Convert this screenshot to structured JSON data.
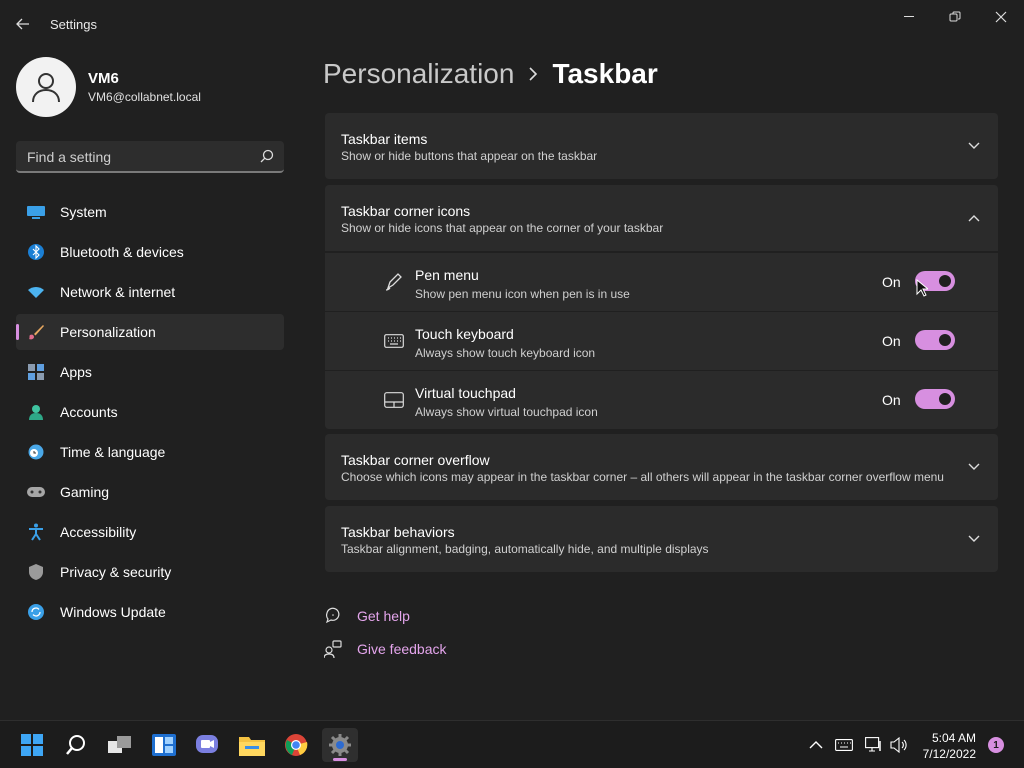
{
  "window": {
    "title": "Settings",
    "controls": [
      "minimize",
      "maximize",
      "close"
    ]
  },
  "profile": {
    "name": "VM6",
    "email": "VM6@collabnet.local"
  },
  "search": {
    "placeholder": "Find a setting"
  },
  "sidebar": {
    "items": [
      {
        "label": "System",
        "icon": "system-icon"
      },
      {
        "label": "Bluetooth & devices",
        "icon": "bluetooth-icon"
      },
      {
        "label": "Network & internet",
        "icon": "wifi-icon"
      },
      {
        "label": "Personalization",
        "icon": "brush-icon",
        "active": true
      },
      {
        "label": "Apps",
        "icon": "apps-icon"
      },
      {
        "label": "Accounts",
        "icon": "accounts-icon"
      },
      {
        "label": "Time & language",
        "icon": "clock-globe-icon"
      },
      {
        "label": "Gaming",
        "icon": "gamepad-icon"
      },
      {
        "label": "Accessibility",
        "icon": "accessibility-icon"
      },
      {
        "label": "Privacy & security",
        "icon": "shield-icon"
      },
      {
        "label": "Windows Update",
        "icon": "update-icon"
      }
    ]
  },
  "breadcrumb": {
    "parent": "Personalization",
    "current": "Taskbar"
  },
  "sections": [
    {
      "title": "Taskbar items",
      "subtitle": "Show or hide buttons that appear on the taskbar",
      "expanded": false
    },
    {
      "title": "Taskbar corner icons",
      "subtitle": "Show or hide icons that appear on the corner of your taskbar",
      "expanded": true
    },
    {
      "title": "Taskbar corner overflow",
      "subtitle": "Choose which icons may appear in the taskbar corner – all others will appear in the taskbar corner overflow menu",
      "expanded": false
    },
    {
      "title": "Taskbar behaviors",
      "subtitle": "Taskbar alignment, badging, automatically hide, and multiple displays",
      "expanded": false
    }
  ],
  "corner_icons": [
    {
      "title": "Pen menu",
      "desc": "Show pen menu icon when pen is in use",
      "state": "On",
      "icon": "pen-icon"
    },
    {
      "title": "Touch keyboard",
      "desc": "Always show touch keyboard icon",
      "state": "On",
      "icon": "keyboard-icon"
    },
    {
      "title": "Virtual touchpad",
      "desc": "Always show virtual touchpad icon",
      "state": "On",
      "icon": "touchpad-icon"
    }
  ],
  "help": {
    "get_help": "Get help",
    "give_feedback": "Give feedback"
  },
  "taskbar": {
    "apps": [
      "start-icon",
      "search-icon",
      "task-view-icon",
      "widgets-icon",
      "chat-icon",
      "file-explorer-icon",
      "chrome-icon",
      "settings-icon"
    ],
    "time": "5:04 AM",
    "date": "7/12/2022",
    "notifications": "1"
  },
  "colors": {
    "accent": "#d78fe0",
    "background": "#202020",
    "card": "#2b2b2b"
  }
}
